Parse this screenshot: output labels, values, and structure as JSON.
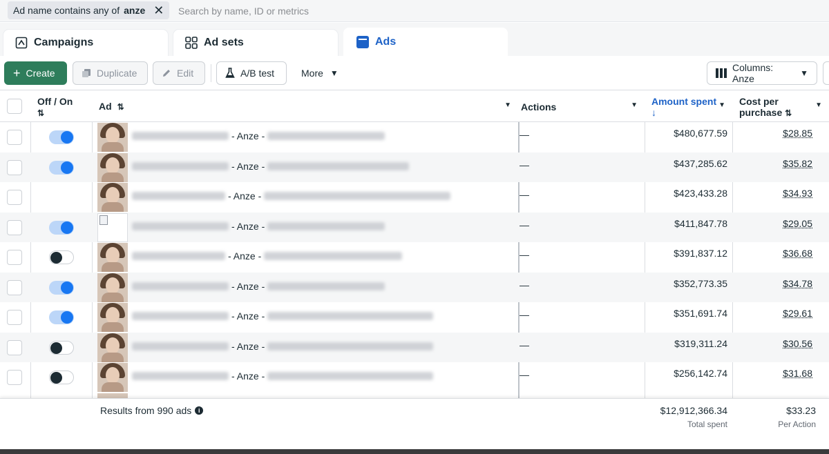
{
  "filter": {
    "chip_prefix": "Ad name contains any of",
    "chip_value": "anze",
    "search_placeholder": "Search by name, ID or metrics"
  },
  "tabs": [
    {
      "label": "Campaigns",
      "icon": "campaign-icon",
      "active": false
    },
    {
      "label": "Ad sets",
      "icon": "grid-icon",
      "active": false
    },
    {
      "label": "Ads",
      "icon": "ad-icon",
      "active": true
    }
  ],
  "toolbar": {
    "create": "Create",
    "duplicate": "Duplicate",
    "edit": "Edit",
    "ab_test": "A/B test",
    "more": "More",
    "columns": "Columns: Anze"
  },
  "headers": {
    "off_on": "Off / On",
    "ad": "Ad",
    "actions": "Actions",
    "amount_spent": "Amount spent",
    "cost_per_purchase_1": "Cost per",
    "cost_per_purchase_2": "purchase"
  },
  "colors": {
    "accent": "#1877f2",
    "create_green": "#2e7d5b",
    "sort_active": "#1d62c7"
  },
  "rows": [
    {
      "toggle": "on",
      "name_mid": "Anze",
      "actions": "—",
      "amount": "$480,677.59",
      "cpp": "$28.85"
    },
    {
      "toggle": "on",
      "name_mid": "Anze",
      "actions": "—",
      "amount": "$437,285.62",
      "cpp": "$35.82"
    },
    {
      "toggle": "none",
      "name_mid": "Anze",
      "actions": "—",
      "amount": "$423,433.28",
      "cpp": "$34.93"
    },
    {
      "toggle": "on",
      "name_mid": "Anze",
      "actions": "—",
      "amount": "$411,847.78",
      "cpp": "$29.05"
    },
    {
      "toggle": "off",
      "name_mid": "Anze",
      "actions": "—",
      "amount": "$391,837.12",
      "cpp": "$36.68"
    },
    {
      "toggle": "on",
      "name_mid": "Anze",
      "actions": "—",
      "amount": "$352,773.35",
      "cpp": "$34.78"
    },
    {
      "toggle": "on",
      "name_mid": "Anze",
      "actions": "—",
      "amount": "$351,691.74",
      "cpp": "$29.61"
    },
    {
      "toggle": "off",
      "name_mid": "Anze",
      "actions": "—",
      "amount": "$319,311.24",
      "cpp": "$30.56"
    },
    {
      "toggle": "off",
      "name_mid": "Anze",
      "actions": "—",
      "amount": "$256,142.74",
      "cpp": "$31.68"
    }
  ],
  "footer": {
    "results": "Results from 990 ads",
    "total_spent": "$12,912,366.34",
    "total_spent_label": "Total spent",
    "per_action": "$33.23",
    "per_action_label": "Per Action"
  }
}
